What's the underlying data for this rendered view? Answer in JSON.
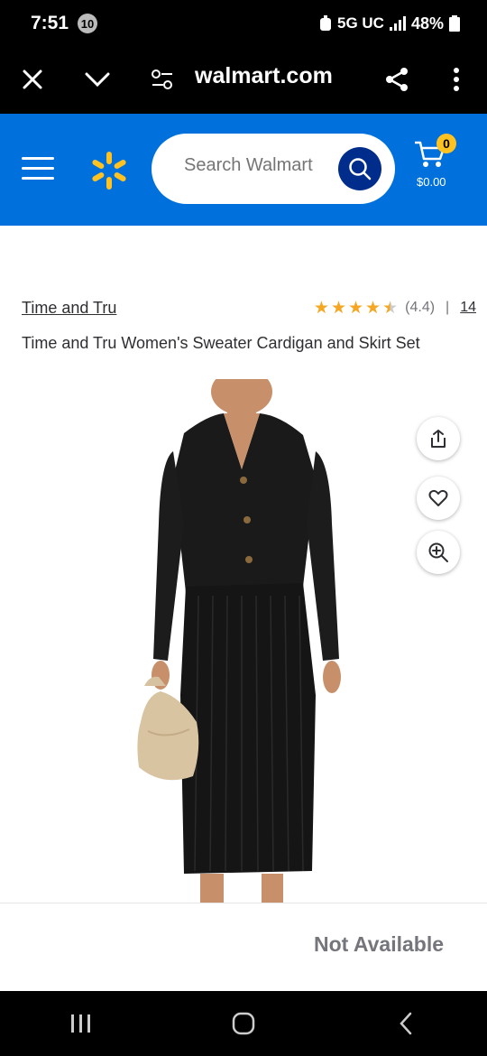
{
  "status_bar": {
    "time": "7:51",
    "notification_count": "10",
    "network": "5G UC",
    "battery": "48%"
  },
  "browser": {
    "url": "walmart.com",
    "icons": [
      "close-icon",
      "chevron-down-icon",
      "tune-icon",
      "share-icon",
      "more-vert-icon"
    ]
  },
  "header": {
    "search_placeholder": "Search Walmart",
    "cart_count": "0",
    "cart_total": "$0.00",
    "brand_color": "#0071dc",
    "accent_color": "#ffc220"
  },
  "product": {
    "brand": "Time and Tru",
    "rating": 4.4,
    "rating_text": "(4.4)",
    "rating_separator": "|",
    "review_count": "14",
    "title": "Time and Tru Women's Sweater Cardigan and Skirt Set",
    "image_alt_icons": [
      "share-icon",
      "heart-icon",
      "zoom-in-icon"
    ]
  },
  "availability": {
    "status": "Not Available"
  },
  "system_nav": {
    "icons": [
      "recents-icon",
      "home-icon",
      "back-icon"
    ]
  }
}
